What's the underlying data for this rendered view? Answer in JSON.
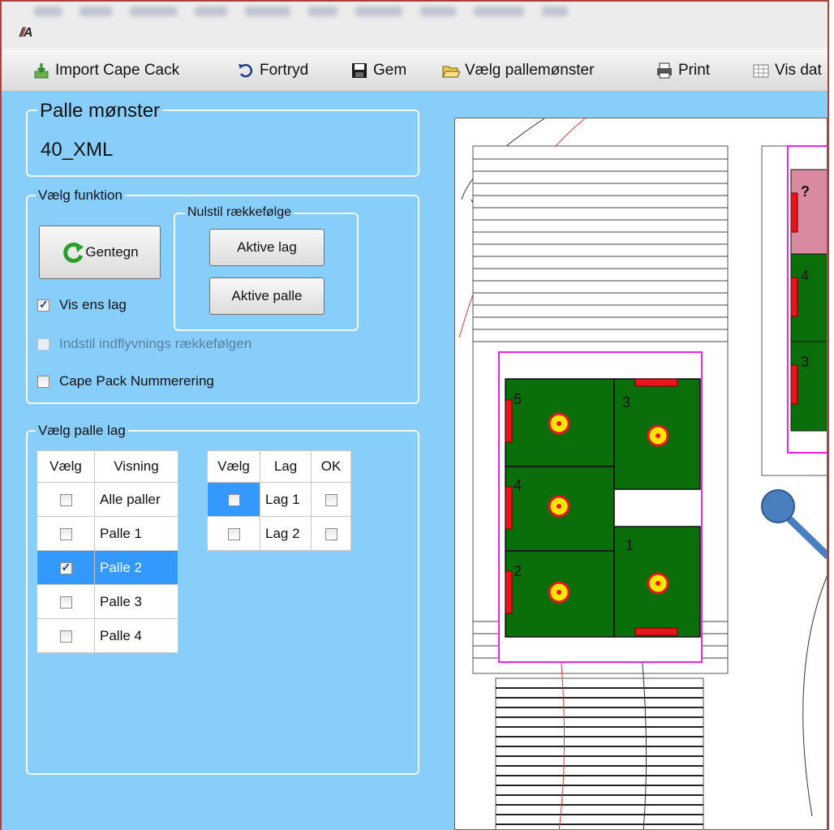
{
  "toolbar": {
    "items": [
      {
        "label": "Import Cape Cack",
        "icon": "import-icon"
      },
      {
        "label": "Fortryd",
        "icon": "undo-icon"
      },
      {
        "label": "Gem",
        "icon": "save-icon"
      },
      {
        "label": "Vælg pallemønster",
        "icon": "open-folder-icon"
      },
      {
        "label": "Print",
        "icon": "printer-icon"
      },
      {
        "label": "Vis dat",
        "icon": "grid-icon"
      }
    ]
  },
  "pattern": {
    "legend": "Palle mønster",
    "value": "40_XML"
  },
  "functions": {
    "legend": "Vælg funktion",
    "redraw_label": "Gentegn",
    "reset_group_legend": "Nulstil rækkefølge",
    "active_layer_label": "Aktive lag",
    "active_pallet_label": "Aktive palle",
    "show_same_layers_label": "Vis ens lag",
    "show_same_layers_checked": true,
    "approach_order_label": "Indstil indflyvnings rækkefølgen",
    "approach_order_enabled": false,
    "cape_pack_numbering_label": "Cape Pack Nummerering"
  },
  "pallet_layers": {
    "legend": "Vælg palle  lag",
    "pallet_table": {
      "headers": [
        "Vælg",
        "Visning"
      ],
      "rows": [
        {
          "label": "Alle paller",
          "checked": false,
          "selected": false
        },
        {
          "label": "Palle 1",
          "checked": false,
          "selected": false
        },
        {
          "label": "Palle 2",
          "checked": true,
          "selected": true
        },
        {
          "label": "Palle 3",
          "checked": false,
          "selected": false
        },
        {
          "label": "Palle 4",
          "checked": false,
          "selected": false
        }
      ]
    },
    "layer_table": {
      "headers": [
        "Vælg",
        "Lag",
        "OK"
      ],
      "rows": [
        {
          "label": "Lag 1",
          "checked": false,
          "ok": false,
          "selected": true
        },
        {
          "label": "Lag 2",
          "checked": false,
          "ok": false,
          "selected": false
        }
      ]
    }
  },
  "drawing": {
    "left_pallet_boxes": [
      "5",
      "3",
      "4",
      "1",
      "2"
    ],
    "right_pallet_boxes": [
      "?",
      "4",
      "3"
    ],
    "colors": {
      "box_fill": "#0a6e0a",
      "box_highlight": "#d98aa0",
      "marker_red": "#e8161c",
      "target_yellow": "#ffe600",
      "pallet_outline": "#ee22ee",
      "robot_arm": "#4a7fbf"
    }
  }
}
